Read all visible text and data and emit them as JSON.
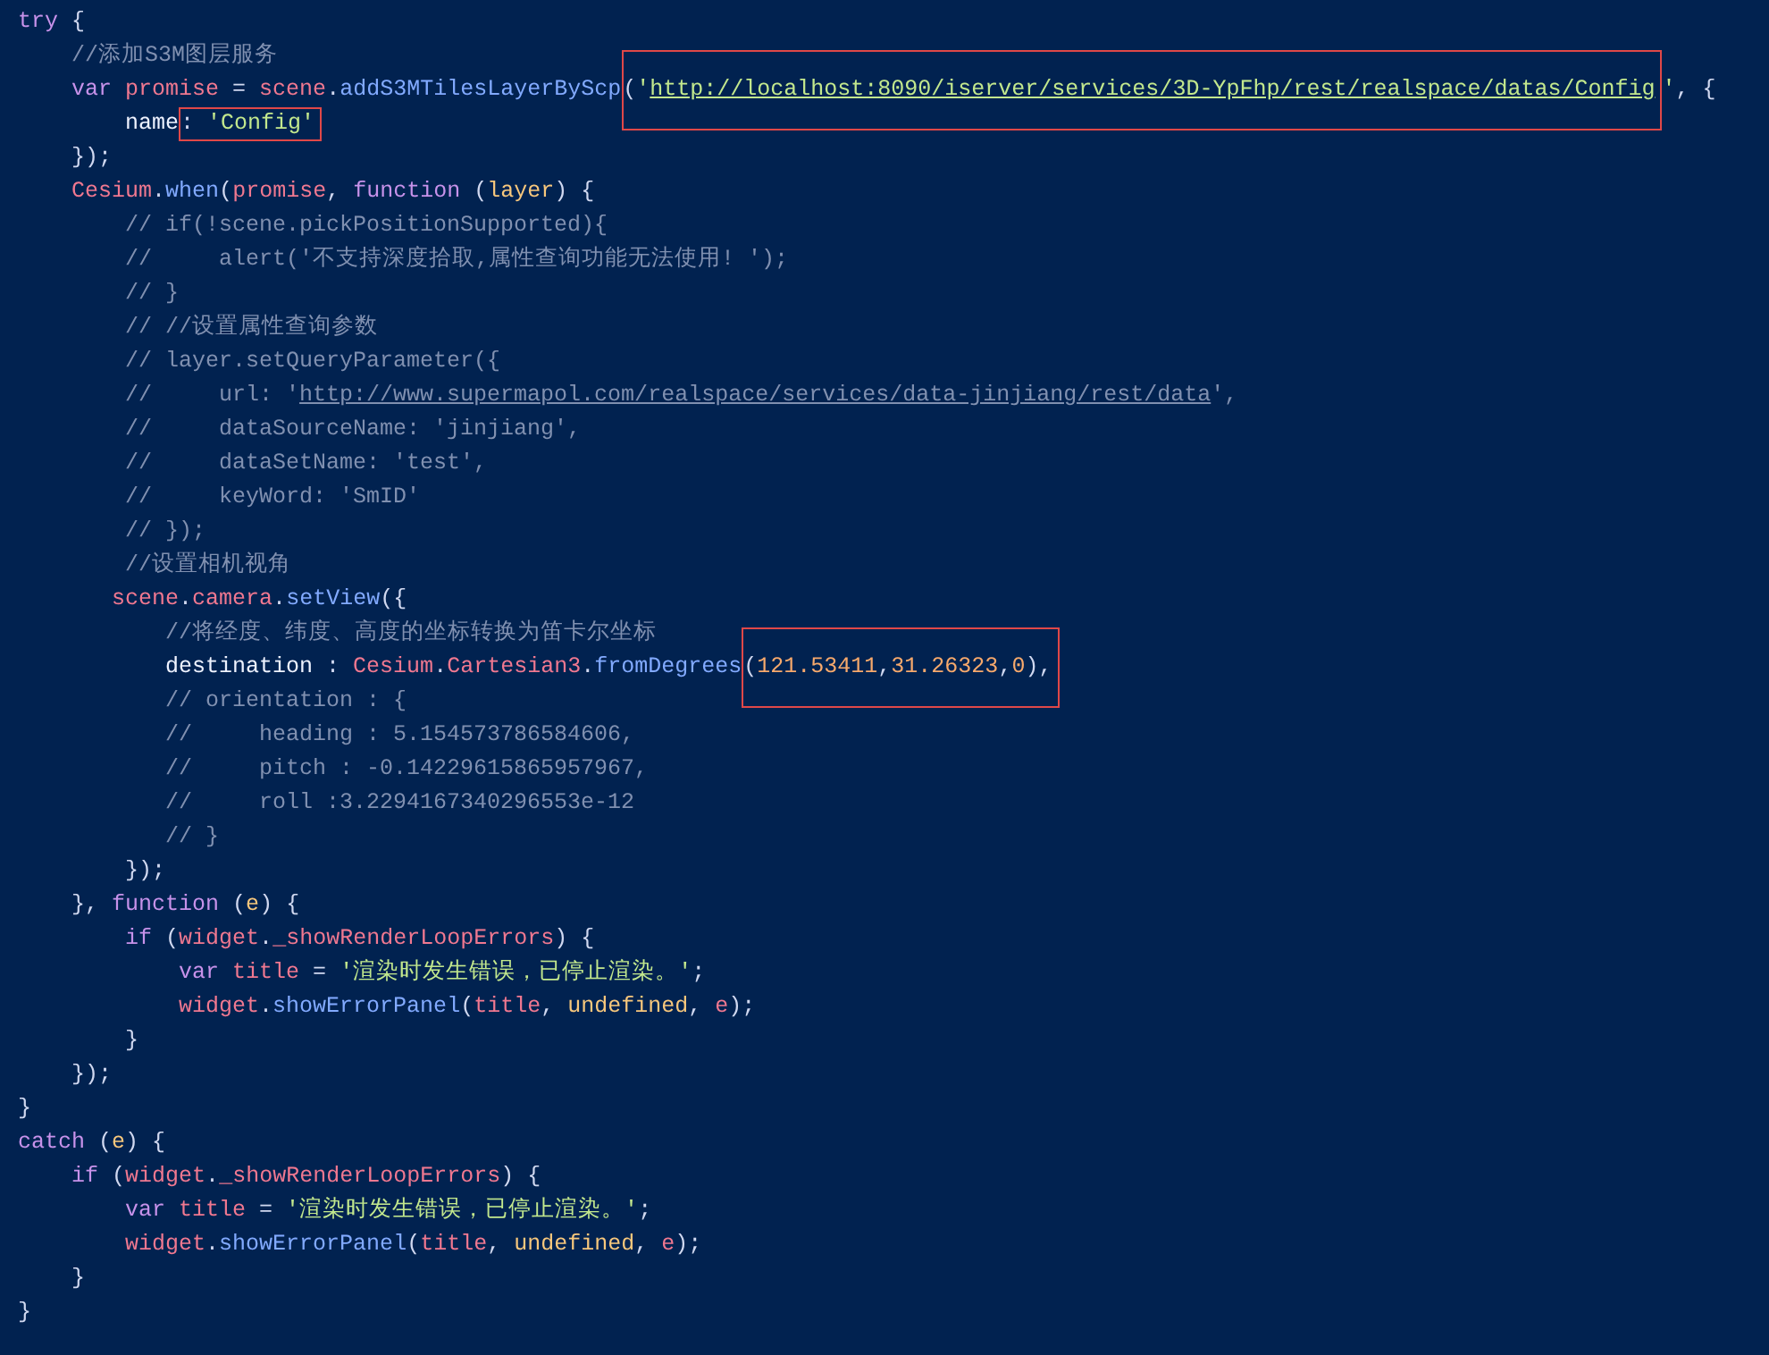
{
  "editor": {
    "lines": [
      {
        "tokens": [
          {
            "text": "try",
            "kind": "kw"
          },
          {
            "text": " {",
            "kind": "punc"
          }
        ]
      },
      {
        "tokens": [
          {
            "text": "    //添加S3M图层服务",
            "kind": "cmt"
          }
        ]
      },
      {
        "tokens": [
          {
            "text": "    var ",
            "kind": "kw"
          },
          {
            "text": "promise",
            "kind": "var"
          },
          {
            "text": " = ",
            "kind": "punc"
          },
          {
            "text": "scene",
            "kind": "var"
          },
          {
            "text": ".",
            "kind": "punc"
          },
          {
            "text": "addS3MTilesLayerByScp",
            "kind": "fn"
          },
          {
            "kind": "box",
            "tokens": [
              {
                "text": "(",
                "kind": "punc"
              },
              {
                "text": "'",
                "kind": "str"
              },
              {
                "text": "http://localhost:8090/iserver/services/3D-YpFhp/rest/realspace/datas/Config",
                "kind": "url"
              }
            ]
          },
          {
            "text": "'",
            "kind": "str"
          },
          {
            "text": ", {",
            "kind": "punc"
          }
        ]
      },
      {
        "tokens": [
          {
            "text": "        name",
            "kind": "prop"
          },
          {
            "kind": "box",
            "tokens": [
              {
                "text": ": ",
                "kind": "punc"
              },
              {
                "text": "'Config'",
                "kind": "str"
              }
            ]
          }
        ]
      },
      {
        "tokens": [
          {
            "text": "    });",
            "kind": "punc"
          }
        ]
      },
      {
        "tokens": [
          {
            "text": "    Cesium",
            "kind": "var"
          },
          {
            "text": ".",
            "kind": "punc"
          },
          {
            "text": "when",
            "kind": "fn"
          },
          {
            "text": "(",
            "kind": "punc"
          },
          {
            "text": "promise",
            "kind": "var"
          },
          {
            "text": ", ",
            "kind": "punc"
          },
          {
            "text": "function",
            "kind": "kw"
          },
          {
            "text": " (",
            "kind": "punc"
          },
          {
            "text": "layer",
            "kind": "param"
          },
          {
            "text": ") {",
            "kind": "punc"
          }
        ]
      },
      {
        "tokens": [
          {
            "text": "        // if(!scene.pickPositionSupported){",
            "kind": "cmt"
          }
        ]
      },
      {
        "tokens": [
          {
            "text": "        //     alert('不支持深度拾取,属性查询功能无法使用! ');",
            "kind": "cmt"
          }
        ]
      },
      {
        "tokens": [
          {
            "text": "        // }",
            "kind": "cmt"
          }
        ]
      },
      {
        "tokens": [
          {
            "text": "        // //设置属性查询参数",
            "kind": "cmt"
          }
        ]
      },
      {
        "tokens": [
          {
            "text": "        // layer.setQueryParameter({",
            "kind": "cmt"
          }
        ]
      },
      {
        "tokens": [
          {
            "text": "        //     url: '",
            "kind": "cmt"
          },
          {
            "text": "http://www.supermapol.com/realspace/services/data-jinjiang/rest/data",
            "kind": "cmturl"
          },
          {
            "text": "',",
            "kind": "cmt"
          }
        ]
      },
      {
        "tokens": [
          {
            "text": "        //     dataSourceName: 'jinjiang',",
            "kind": "cmt"
          }
        ]
      },
      {
        "tokens": [
          {
            "text": "        //     dataSetName: 'test',",
            "kind": "cmt"
          }
        ]
      },
      {
        "tokens": [
          {
            "text": "        //     keyWord: 'SmID'",
            "kind": "cmt"
          }
        ]
      },
      {
        "tokens": [
          {
            "text": "        // });",
            "kind": "cmt"
          }
        ]
      },
      {
        "tokens": [
          {
            "text": "        //设置相机视角",
            "kind": "cmt"
          }
        ]
      },
      {
        "tokens": [
          {
            "text": "       scene",
            "kind": "var"
          },
          {
            "text": ".",
            "kind": "punc"
          },
          {
            "text": "camera",
            "kind": "var"
          },
          {
            "text": ".",
            "kind": "punc"
          },
          {
            "text": "setView",
            "kind": "fn"
          },
          {
            "text": "({",
            "kind": "punc"
          }
        ]
      },
      {
        "tokens": [
          {
            "text": "           //将经度、纬度、高度的坐标转换为笛卡尔坐标",
            "kind": "cmt"
          }
        ]
      },
      {
        "tokens": [
          {
            "text": "           destination",
            "kind": "prop"
          },
          {
            "text": " : ",
            "kind": "punc"
          },
          {
            "text": "Cesium",
            "kind": "var"
          },
          {
            "text": ".",
            "kind": "punc"
          },
          {
            "text": "Cartesian3",
            "kind": "var"
          },
          {
            "text": ".",
            "kind": "punc"
          },
          {
            "text": "fromDegrees",
            "kind": "fn"
          },
          {
            "kind": "box",
            "tokens": [
              {
                "text": "(",
                "kind": "punc"
              },
              {
                "text": "121.53411",
                "kind": "num"
              },
              {
                "text": ",",
                "kind": "punc"
              },
              {
                "text": "31.26323",
                "kind": "num"
              },
              {
                "text": ",",
                "kind": "punc"
              },
              {
                "text": "0",
                "kind": "num"
              },
              {
                "text": "),",
                "kind": "punc"
              }
            ]
          }
        ]
      },
      {
        "tokens": [
          {
            "text": "           // orientation : {",
            "kind": "cmt"
          }
        ]
      },
      {
        "tokens": [
          {
            "text": "           //     heading : 5.154573786584606,",
            "kind": "cmt"
          }
        ]
      },
      {
        "tokens": [
          {
            "text": "           //     pitch : -0.14229615865957967,",
            "kind": "cmt"
          }
        ]
      },
      {
        "tokens": [
          {
            "text": "           //     roll :3.2294167340296553e-12",
            "kind": "cmt"
          }
        ]
      },
      {
        "tokens": [
          {
            "text": "           // }",
            "kind": "cmt"
          }
        ]
      },
      {
        "tokens": [
          {
            "text": "        });",
            "kind": "punc"
          }
        ]
      },
      {
        "tokens": [
          {
            "text": "    }, ",
            "kind": "punc"
          },
          {
            "text": "function",
            "kind": "kw"
          },
          {
            "text": " (",
            "kind": "punc"
          },
          {
            "text": "e",
            "kind": "param"
          },
          {
            "text": ") {",
            "kind": "punc"
          }
        ]
      },
      {
        "tokens": [
          {
            "text": "        if",
            "kind": "kw"
          },
          {
            "text": " (",
            "kind": "punc"
          },
          {
            "text": "widget",
            "kind": "var"
          },
          {
            "text": ".",
            "kind": "punc"
          },
          {
            "text": "_showRenderLoopErrors",
            "kind": "var"
          },
          {
            "text": ") {",
            "kind": "punc"
          }
        ]
      },
      {
        "tokens": [
          {
            "text": "            var ",
            "kind": "kw"
          },
          {
            "text": "title",
            "kind": "var"
          },
          {
            "text": " = ",
            "kind": "punc"
          },
          {
            "text": "'渲染时发生错误，已停止渲染。'",
            "kind": "str"
          },
          {
            "text": ";",
            "kind": "punc"
          }
        ]
      },
      {
        "tokens": [
          {
            "text": "            widget",
            "kind": "var"
          },
          {
            "text": ".",
            "kind": "punc"
          },
          {
            "text": "showErrorPanel",
            "kind": "fn"
          },
          {
            "text": "(",
            "kind": "punc"
          },
          {
            "text": "title",
            "kind": "var"
          },
          {
            "text": ", ",
            "kind": "punc"
          },
          {
            "text": "undefined",
            "kind": "const"
          },
          {
            "text": ", ",
            "kind": "punc"
          },
          {
            "text": "e",
            "kind": "var"
          },
          {
            "text": ");",
            "kind": "punc"
          }
        ]
      },
      {
        "tokens": [
          {
            "text": "        }",
            "kind": "punc"
          }
        ]
      },
      {
        "tokens": [
          {
            "text": "    });",
            "kind": "punc"
          }
        ]
      },
      {
        "tokens": [
          {
            "text": "}",
            "kind": "punc"
          }
        ]
      },
      {
        "tokens": [
          {
            "text": "catch",
            "kind": "kw"
          },
          {
            "text": " (",
            "kind": "punc"
          },
          {
            "text": "e",
            "kind": "param"
          },
          {
            "text": ") {",
            "kind": "punc"
          }
        ]
      },
      {
        "tokens": [
          {
            "text": "    if",
            "kind": "kw"
          },
          {
            "text": " (",
            "kind": "punc"
          },
          {
            "text": "widget",
            "kind": "var"
          },
          {
            "text": ".",
            "kind": "punc"
          },
          {
            "text": "_showRenderLoopErrors",
            "kind": "var"
          },
          {
            "text": ") {",
            "kind": "punc"
          }
        ]
      },
      {
        "tokens": [
          {
            "text": "        var ",
            "kind": "kw"
          },
          {
            "text": "title",
            "kind": "var"
          },
          {
            "text": " = ",
            "kind": "punc"
          },
          {
            "text": "'渲染时发生错误，已停止渲染。'",
            "kind": "str"
          },
          {
            "text": ";",
            "kind": "punc"
          }
        ]
      },
      {
        "tokens": [
          {
            "text": "        widget",
            "kind": "var"
          },
          {
            "text": ".",
            "kind": "punc"
          },
          {
            "text": "showErrorPanel",
            "kind": "fn"
          },
          {
            "text": "(",
            "kind": "punc"
          },
          {
            "text": "title",
            "kind": "var"
          },
          {
            "text": ", ",
            "kind": "punc"
          },
          {
            "text": "undefined",
            "kind": "const"
          },
          {
            "text": ", ",
            "kind": "punc"
          },
          {
            "text": "e",
            "kind": "var"
          },
          {
            "text": ");",
            "kind": "punc"
          }
        ]
      },
      {
        "tokens": [
          {
            "text": "    }",
            "kind": "punc"
          }
        ]
      },
      {
        "tokens": [
          {
            "text": "}",
            "kind": "punc"
          }
        ]
      }
    ]
  }
}
